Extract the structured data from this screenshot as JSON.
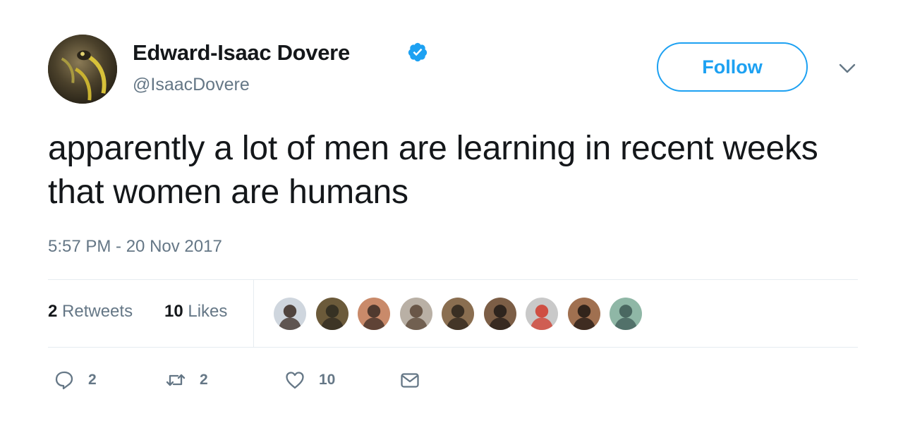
{
  "tweet": {
    "author": {
      "display_name": "Edward-Isaac Dovere",
      "handle": "@IsaacDovere",
      "verified": true,
      "avatar_icon": "avatar-photo"
    },
    "follow_label": "Follow",
    "text": "apparently a lot of men are learning in recent weeks that women are humans",
    "timestamp": "5:57 PM - 20 Nov 2017"
  },
  "stats": {
    "retweets_count": "2",
    "retweets_label": "Retweets",
    "likes_count": "10",
    "likes_label": "Likes",
    "liker_avatars": [
      {
        "icon": "liker-avatar-1",
        "colors": [
          "#cfd6de",
          "#3a2a22"
        ]
      },
      {
        "icon": "liker-avatar-2",
        "colors": [
          "#6b5a3a",
          "#2d2a20"
        ]
      },
      {
        "icon": "liker-avatar-3",
        "colors": [
          "#c98a6a",
          "#3b2b25"
        ]
      },
      {
        "icon": "liker-avatar-4",
        "colors": [
          "#b9b0a5",
          "#5a4636"
        ]
      },
      {
        "icon": "liker-avatar-5",
        "colors": [
          "#8a6e50",
          "#2c241b"
        ]
      },
      {
        "icon": "liker-avatar-6",
        "colors": [
          "#7c5e46",
          "#211a16"
        ]
      },
      {
        "icon": "liker-avatar-7",
        "colors": [
          "#c9c9c9",
          "#d0392b"
        ]
      },
      {
        "icon": "liker-avatar-8",
        "colors": [
          "#a07050",
          "#1f1612"
        ]
      },
      {
        "icon": "liker-avatar-9",
        "colors": [
          "#8fb7a6",
          "#3e5a55"
        ]
      }
    ]
  },
  "actions": {
    "reply_count": "2",
    "retweet_count": "2",
    "like_count": "10",
    "reply_icon": "reply-icon",
    "retweet_icon": "retweet-icon",
    "like_icon": "heart-icon",
    "dm_icon": "envelope-icon"
  },
  "colors": {
    "accent": "#1da1f2",
    "text_primary": "#14171a",
    "text_secondary": "#657786",
    "divider": "#e6ecf0"
  }
}
